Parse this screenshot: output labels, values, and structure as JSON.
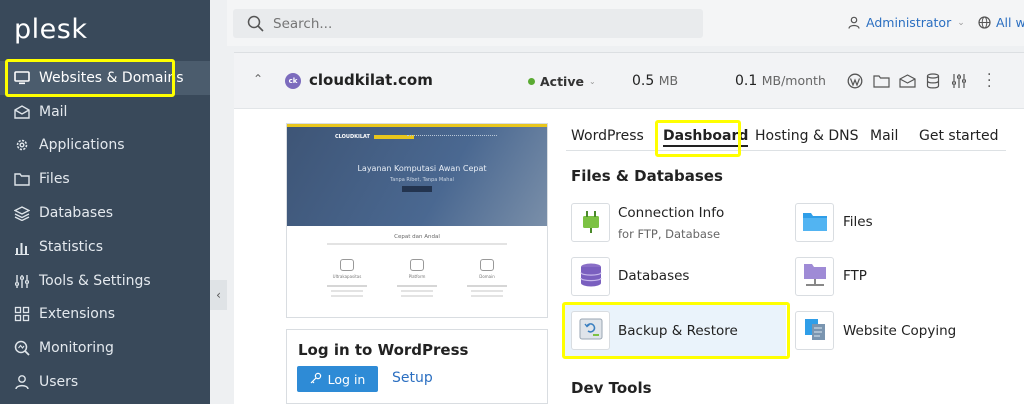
{
  "app": {
    "logo": "plesk"
  },
  "sidebar": {
    "items": [
      {
        "label": "Websites & Domains",
        "icon": "monitor-icon"
      },
      {
        "label": "Mail",
        "icon": "mail-icon"
      },
      {
        "label": "Applications",
        "icon": "gear-icon"
      },
      {
        "label": "Files",
        "icon": "folder-icon"
      },
      {
        "label": "Databases",
        "icon": "database-icon"
      },
      {
        "label": "Statistics",
        "icon": "bar-chart-icon"
      },
      {
        "label": "Tools & Settings",
        "icon": "tools-icon"
      },
      {
        "label": "Extensions",
        "icon": "puzzle-icon"
      },
      {
        "label": "Monitoring",
        "icon": "monitor-gauge-icon"
      },
      {
        "label": "Users",
        "icon": "user-icon"
      }
    ]
  },
  "topbar": {
    "search_placeholder": "Search...",
    "user": "Administrator",
    "scope": "All we"
  },
  "domain": {
    "name": "cloudkilat.com",
    "icon_text": "ck",
    "status": "Active",
    "disk_value": "0.5",
    "disk_unit": "MB",
    "traffic_value": "0.1",
    "traffic_unit": "MB/month"
  },
  "preview": {
    "brand": "CLOUDKILAT",
    "hero_title": "Layanan Komputasi Awan Cepat",
    "hero_sub": "Tanpa Ribet, Tanpa Mahal",
    "section_title": "Cepat dan Andal",
    "features": [
      "Ultrakapasitas",
      "Platform",
      "Domain"
    ]
  },
  "login": {
    "title": "Log in to WordPress",
    "button": "Log in",
    "setup": "Setup"
  },
  "tabs": [
    "WordPress",
    "Dashboard",
    "Hosting & DNS",
    "Mail",
    "Get started"
  ],
  "sections": {
    "files_db": "Files & Databases",
    "dev_tools": "Dev Tools"
  },
  "tiles": {
    "connection_info": {
      "label": "Connection Info",
      "sub": "for FTP, Database"
    },
    "files": "Files",
    "databases": "Databases",
    "ftp": "FTP",
    "backup": "Backup & Restore",
    "website_copying": "Website Copying"
  },
  "colors": {
    "sidebar": "#39495a",
    "link": "#2b6fc1",
    "highlight": "#ffff00",
    "primary_button": "#2e8bd6",
    "active_status": "#5aaa32"
  }
}
